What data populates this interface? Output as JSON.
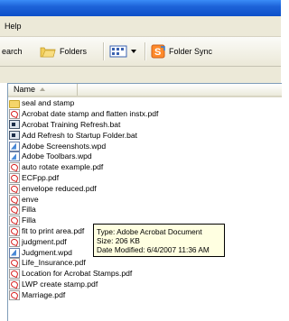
{
  "menubar": {
    "help_label": "Help"
  },
  "toolbar": {
    "search_label": "earch",
    "folders_label": "Folders",
    "folder_sync_label": "Folder Sync"
  },
  "list": {
    "column_name": "Name",
    "items": [
      {
        "name": "seal and stamp",
        "icon": "folder-icon"
      },
      {
        "name": "Acrobat date stamp and flatten instx.pdf",
        "icon": "pdf-file-icon"
      },
      {
        "name": "Acrobat Training Refresh.bat",
        "icon": "batch-file-icon"
      },
      {
        "name": "Add Refresh to Startup Folder.bat",
        "icon": "batch-file-icon"
      },
      {
        "name": "Adobe Screenshots.wpd",
        "icon": "wpd-file-icon"
      },
      {
        "name": "Adobe Toolbars.wpd",
        "icon": "wpd-file-icon"
      },
      {
        "name": "auto rotate example.pdf",
        "icon": "pdf-file-icon"
      },
      {
        "name": "ECFpp.pdf",
        "icon": "pdf-file-icon"
      },
      {
        "name": "envelope reduced.pdf",
        "icon": "pdf-file-icon"
      },
      {
        "name": "enve",
        "icon": "pdf-file-icon"
      },
      {
        "name": "Filla",
        "icon": "pdf-file-icon"
      },
      {
        "name": "Filla",
        "icon": "pdf-file-icon"
      },
      {
        "name": "fit to print area.pdf",
        "icon": "pdf-file-icon"
      },
      {
        "name": "judgment.pdf",
        "icon": "pdf-file-icon"
      },
      {
        "name": "Judgment.wpd",
        "icon": "wpd-file-icon"
      },
      {
        "name": "Life_Insurance.pdf",
        "icon": "pdf-file-icon"
      },
      {
        "name": "Location for Acrobat Stamps.pdf",
        "icon": "pdf-file-icon"
      },
      {
        "name": "LWP create stamp.pdf",
        "icon": "pdf-file-icon"
      },
      {
        "name": "Marriage.pdf",
        "icon": "pdf-file-icon"
      }
    ]
  },
  "tooltip": {
    "type_line": "Type: Adobe Acrobat Document",
    "size_line": "Size: 206 KB",
    "date_line": "Date Modified: 6/4/2007 11:36 AM"
  },
  "colors": {
    "titlebar": "#0d4fc9",
    "chrome": "#ece9d8",
    "tooltip_bg": "#ffffe1",
    "pdf_red": "#d71e1e"
  }
}
